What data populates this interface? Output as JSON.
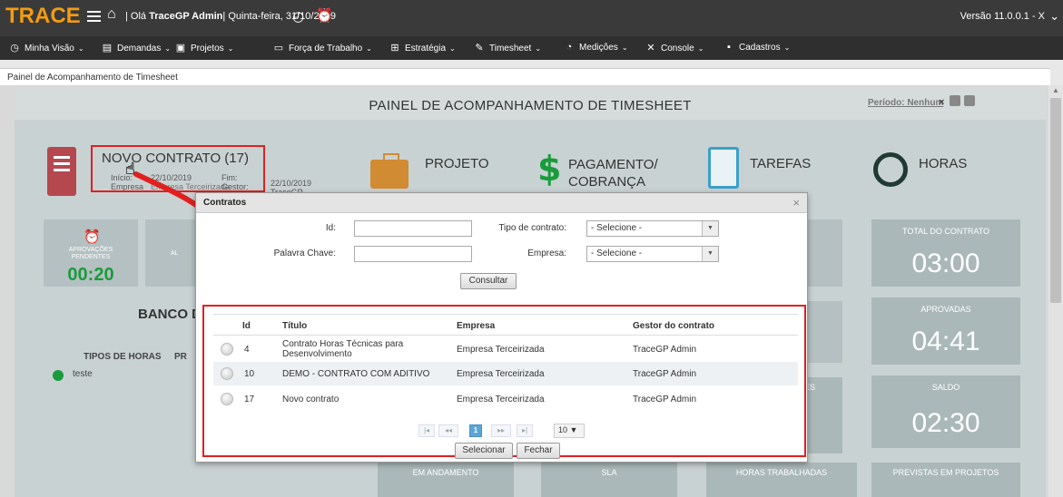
{
  "app": {
    "brand": "TRACE",
    "greeting_prefix": "| Olá",
    "user": "TraceGP Admin",
    "date": "| Quinta-feira, 31/10/2019",
    "version": "Versão 11.0.0.1 - X"
  },
  "menu": [
    {
      "label": "Minha Visão",
      "icon": "alarm-clock-icon"
    },
    {
      "label": "Demandas",
      "icon": "document-icon"
    },
    {
      "label": "Projetos",
      "icon": "briefcase-icon"
    },
    {
      "label": "Força de Trabalho",
      "icon": "chart-icon"
    },
    {
      "label": "Estratégia",
      "icon": "hierarchy-icon"
    },
    {
      "label": "Timesheet",
      "icon": "pen-icon"
    },
    {
      "label": "Medições",
      "icon": "pie-icon"
    },
    {
      "label": "Console",
      "icon": "tools-icon"
    },
    {
      "label": "Cadastros",
      "icon": "folder-icon"
    }
  ],
  "tab": {
    "label": "Painel de Acompanhamento de Timesheet"
  },
  "panel": {
    "title": "PAINEL DE ACOMPANHAMENTO DE TIMESHEET",
    "periodo": "Período: Nenhum",
    "contract": {
      "title": "NOVO CONTRATO (17)",
      "inicio_label": "Início:",
      "inicio": "22/10/2019",
      "fim_label": "Fim:",
      "fim": "22/10/2019",
      "empresa_label": "Empresa",
      "empresa": "Empresa Terceirizada",
      "gestor_label": "Gestor:",
      "gestor": "TraceGP"
    },
    "sections": {
      "projeto": "PROJETO",
      "pagamento_1": "PAGAMENTO/",
      "pagamento_2": "COBRANÇA",
      "tarefas": "TAREFAS",
      "horas": "HORAS"
    },
    "aprovacoes": {
      "label_1": "APROVAÇÕES",
      "label_2": "PENDENTES",
      "value": "00:20"
    },
    "ali_label": "AL",
    "banco": "BANCO D",
    "tipos_header": "TIPOS DE HORAS",
    "tipos_header_2": "PR",
    "tipos_row": "teste",
    "stats": {
      "total_label": "TOTAL DO CONTRATO",
      "total": "03:00",
      "aprovadas_label": "APROVADAS",
      "aprovadas": "04:41",
      "saldo_label": "SALDO",
      "saldo": "02:30",
      "previstas_label": "PREVISTAS EM PROJETOS"
    },
    "bottom": {
      "andamento": "EM ANDAMENTO",
      "sla": "SLA",
      "horas_trab": "HORAS TRABALHADAS",
      "es_label": "ES"
    }
  },
  "modal": {
    "title": "Contratos",
    "id_label": "Id:",
    "id_value": "",
    "palavra_label": "Palavra Chave:",
    "palavra_value": "",
    "tipo_label": "Tipo de contrato:",
    "tipo_value": "- Selecione -",
    "empresa_label": "Empresa:",
    "empresa_value": "- Selecione -",
    "consultar": "Consultar",
    "columns": {
      "id": "Id",
      "titulo": "Título",
      "empresa": "Empresa",
      "gestor": "Gestor do contrato"
    },
    "rows": [
      {
        "id": "4",
        "titulo": "Contrato Horas Técnicas para Desenvolvimento",
        "empresa": "Empresa Terceirizada",
        "gestor": "TraceGP Admin"
      },
      {
        "id": "10",
        "titulo": "DEMO - CONTRATO COM ADITIVO",
        "empresa": "Empresa Terceirizada",
        "gestor": "TraceGP Admin"
      },
      {
        "id": "17",
        "titulo": "Novo contrato",
        "empresa": "Empresa Terceirizada",
        "gestor": "TraceGP Admin"
      }
    ],
    "pager": {
      "first": "|◂",
      "prev": "◂◂",
      "current": "1",
      "next": "▸▸",
      "last": "▸|",
      "page_size": "10"
    },
    "selecionar": "Selecionar",
    "fechar": "Fechar"
  }
}
